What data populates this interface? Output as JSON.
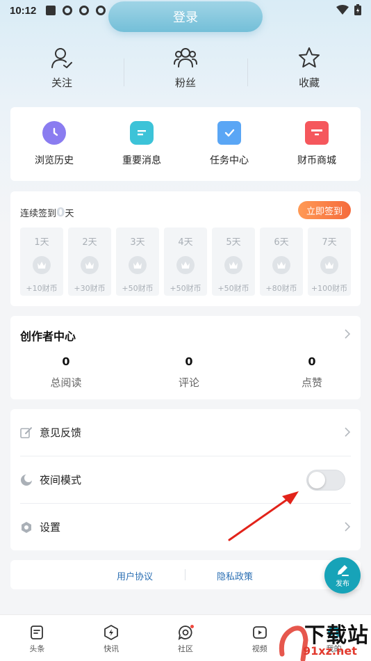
{
  "status_bar": {
    "time": "10:12"
  },
  "header": {
    "login_label": "登录"
  },
  "quick_links": [
    {
      "label": "关注",
      "icon": "user-check-icon"
    },
    {
      "label": "粉丝",
      "icon": "users-icon"
    },
    {
      "label": "收藏",
      "icon": "star-icon"
    }
  ],
  "functions": [
    {
      "label": "浏览历史",
      "icon": "clock-icon",
      "color": "#8a7cf0"
    },
    {
      "label": "重要消息",
      "icon": "message-icon",
      "color": "#3cc3d8"
    },
    {
      "label": "任务中心",
      "icon": "task-clipboard-icon",
      "color": "#5aa6f5"
    },
    {
      "label": "财币商城",
      "icon": "store-icon",
      "color": "#f5575c"
    }
  ],
  "checkin": {
    "title_prefix": "连续签到",
    "count": "0",
    "title_suffix": "天",
    "button_label": "立即签到",
    "days": [
      {
        "day": "1天",
        "reward": "+10财币"
      },
      {
        "day": "2天",
        "reward": "+30财币"
      },
      {
        "day": "3天",
        "reward": "+50财币"
      },
      {
        "day": "4天",
        "reward": "+50财币"
      },
      {
        "day": "5天",
        "reward": "+50财币"
      },
      {
        "day": "6天",
        "reward": "+80财币"
      },
      {
        "day": "7天",
        "reward": "+100财币"
      }
    ]
  },
  "creator": {
    "title": "创作者中心",
    "stats": [
      {
        "value": "0",
        "label": "总阅读"
      },
      {
        "value": "0",
        "label": "评论"
      },
      {
        "value": "0",
        "label": "点赞"
      }
    ]
  },
  "settings": {
    "feedback": "意见反馈",
    "night_mode": "夜间模式",
    "night_mode_on": false,
    "settings": "设置"
  },
  "links": {
    "user_agreement": "用户协议",
    "privacy_policy": "隐私政策"
  },
  "fab": {
    "label": "发布"
  },
  "tabs": [
    {
      "label": "头条",
      "icon": "news-icon"
    },
    {
      "label": "快讯",
      "icon": "flash-icon"
    },
    {
      "label": "社区",
      "icon": "community-icon"
    },
    {
      "label": "视频",
      "icon": "video-icon"
    },
    {
      "label": "我的",
      "icon": "profile-icon"
    }
  ],
  "watermark": {
    "main": "下载站",
    "sub": "91xz.net"
  },
  "colors": {
    "accent": "#17a3b8",
    "checkin_button": "#f56a3c",
    "link": "#2b6fb3"
  }
}
